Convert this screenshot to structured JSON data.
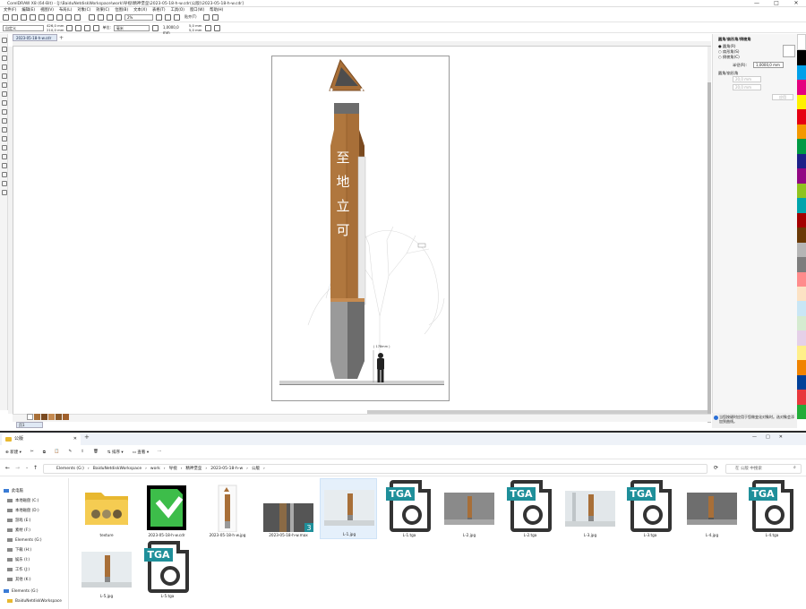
{
  "app": {
    "title": "CorelDRAW X8 (64-Bit) - [J:\\BaiduNetdiskWorkspace\\work\\导视\\精神堡垒\\2023-05-18-h-w.cdr(公版)\\2023-05-18-h-w.cdr]",
    "window_controls": [
      "—",
      "□",
      "✕"
    ],
    "menu": [
      "文件(F)",
      "编辑(E)",
      "视图(V)",
      "布局(L)",
      "对象(C)",
      "效果(C)",
      "位图(B)",
      "文本(X)",
      "表格(T)",
      "工具(O)",
      "窗口(W)",
      "帮助(H)"
    ],
    "toolbar": {
      "zoom": "2%",
      "snap_label": "贴齐(T)",
      "paper_type": "自定义",
      "width": "426,0 mm",
      "height": "210,0 mm",
      "units_label": "单位:",
      "units": "毫米",
      "nudge": "1,0000,0 mm",
      "dup_x": "5,0 mm",
      "dup_y": "5,0 mm"
    },
    "doc_tab": "2023-05-18-h-w.cdr",
    "page_tab": "页1"
  },
  "artwork": {
    "title_chars": [
      "至",
      "地",
      "立",
      "可"
    ],
    "human_label": "( 178mm )",
    "colors": {
      "wood": "#a86f38",
      "wood_dark": "#7a4a20",
      "gray": "#9a9a9a",
      "gray_dark": "#6c6c6c",
      "cap": "#4d4d4d"
    }
  },
  "dock": {
    "header": "圆角/扇形角/倒棱角",
    "options": [
      "圆角(R)",
      "扇形角(S)",
      "倒棱角(C)"
    ],
    "radius_label": "半径(R):",
    "radius_value": "1,0000,0 mm",
    "section": "圆角/扇形角",
    "field1": "20,0 mm",
    "field2": "20,0 mm",
    "apply": "应用",
    "tip": "当您按键时应用于您做变化对象时。选对象会添加到曲线。"
  },
  "explorer": {
    "tab_title": "公版",
    "new_tab": "+",
    "window_controls": [
      "—",
      "□",
      "✕"
    ],
    "commands": [
      "新建",
      "排序",
      "查看",
      "···"
    ],
    "breadcrumb": [
      "Elements (G:)",
      "BaiduNetdiskWorkspace",
      "work",
      "导视",
      "精神堡垒",
      "2023-05-18-h-w",
      "公版"
    ],
    "search_placeholder": "在 公版 中搜索",
    "nav": [
      {
        "label": "此电脑"
      },
      {
        "label": "本地磁盘 (C:)"
      },
      {
        "label": "本地磁盘 (D:)"
      },
      {
        "label": "游戏 (E:)"
      },
      {
        "label": "素材 (F:)"
      },
      {
        "label": "Elements (G:)"
      },
      {
        "label": "下载 (H:)"
      },
      {
        "label": "娱乐 (I:)"
      },
      {
        "label": "工作 (J:)"
      },
      {
        "label": "其他 (K:)"
      },
      {
        "label": "Elements (G:)"
      },
      {
        "label": "BaiduNetdiskWorkspace"
      }
    ],
    "files": [
      {
        "name": "texture",
        "kind": "folder"
      },
      {
        "name": "2023-05-18-h-w.cdr",
        "kind": "cdr"
      },
      {
        "name": "2023-05-18-h-w.jpg",
        "kind": "jpg-tall"
      },
      {
        "name": "2023-05-18-h-w.max",
        "kind": "max",
        "badge": "3"
      },
      {
        "name": "L-1.jpg",
        "kind": "jpg-render",
        "selected": true
      },
      {
        "name": "L-1.tga",
        "kind": "tga",
        "badge": "TGA"
      },
      {
        "name": "L-2.jpg",
        "kind": "jpg-render2"
      },
      {
        "name": "L-2.tga",
        "kind": "tga",
        "badge": "TGA"
      },
      {
        "name": "L-3.jpg",
        "kind": "jpg-render"
      },
      {
        "name": "L-3.tga",
        "kind": "tga",
        "badge": "TGA"
      },
      {
        "name": "L-4.jpg",
        "kind": "jpg-render2"
      },
      {
        "name": "L-4.tga",
        "kind": "tga",
        "badge": "TGA"
      },
      {
        "name": "L-5.jpg",
        "kind": "jpg-render"
      },
      {
        "name": "L-5.tga",
        "kind": "tga",
        "badge": "TGA"
      }
    ]
  }
}
